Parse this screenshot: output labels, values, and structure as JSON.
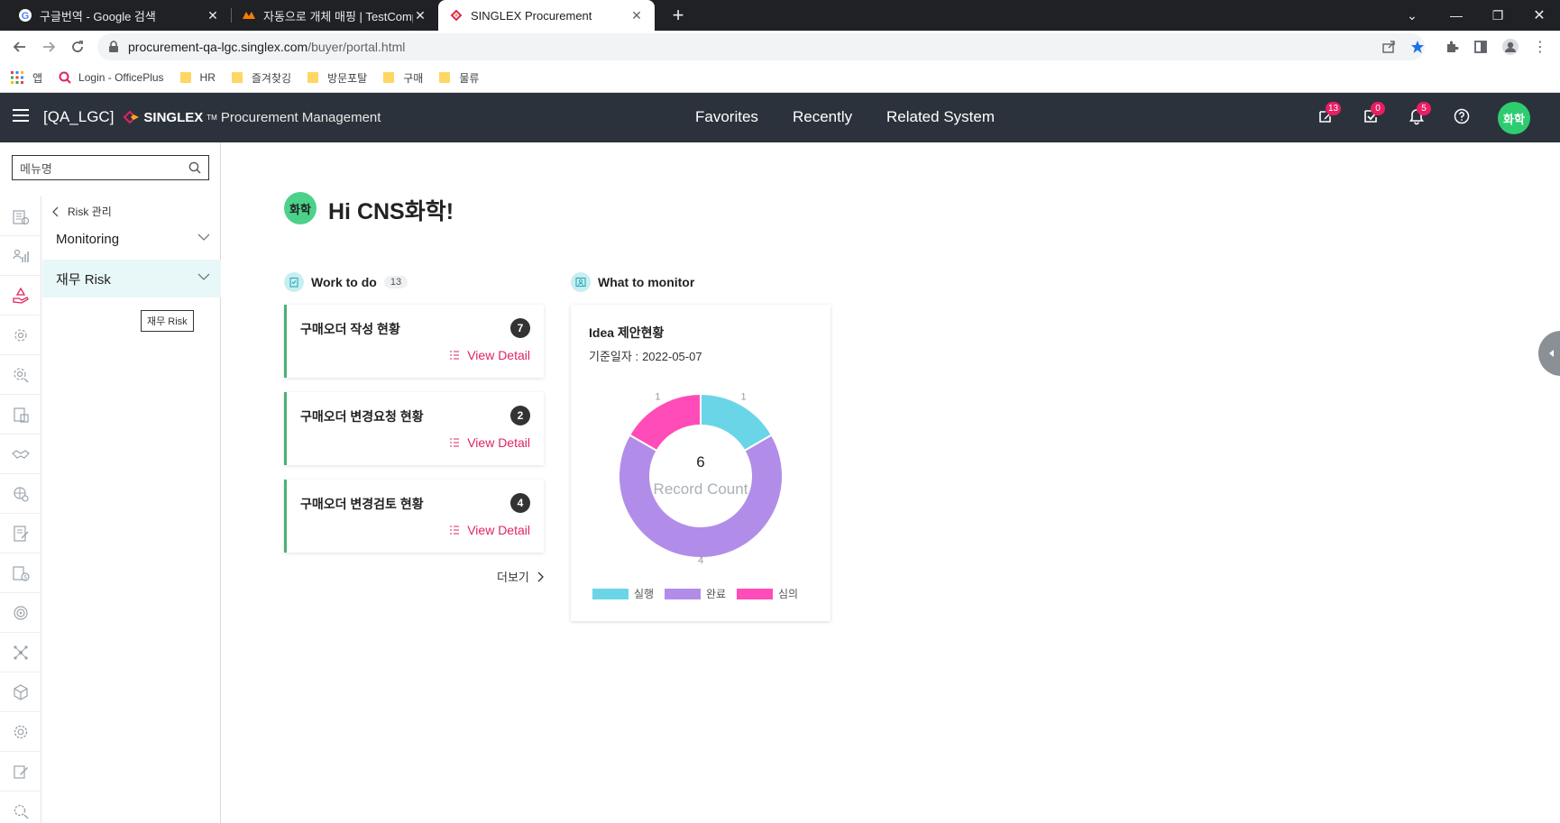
{
  "browser": {
    "tabs": [
      {
        "title": "구글번역 - Google 검색",
        "icon": "google-icon"
      },
      {
        "title": "자동으로 개체 매핑 | TestComplete",
        "icon": "testcomplete-icon"
      },
      {
        "title": "SINGLEX Procurement",
        "icon": "singlex-icon"
      }
    ],
    "new_tab": "+",
    "url_host": "procurement-qa-lgc.singlex.com",
    "url_path": "/buyer/portal.html",
    "bookmarks": [
      {
        "label": "앱",
        "icon": "apps-icon"
      },
      {
        "label": "Login - OfficePlus",
        "icon": "officeplus-icon"
      },
      {
        "label": "HR",
        "icon": "folder-icon"
      },
      {
        "label": "즐겨찾깅",
        "icon": "folder-icon"
      },
      {
        "label": "방문포탈",
        "icon": "folder-icon"
      },
      {
        "label": "구매",
        "icon": "folder-icon"
      },
      {
        "label": "물류",
        "icon": "folder-icon"
      }
    ]
  },
  "header": {
    "company_code": "[QA_LGC]",
    "logo": "SINGLEX",
    "tm": "TM",
    "product": "Procurement Management",
    "nav": [
      "Favorites",
      "Recently",
      "Related System"
    ],
    "badges": {
      "edit": "13",
      "approval": "0",
      "notification": "5"
    },
    "avatar": "화학"
  },
  "sidebar": {
    "search_placeholder": "메뉴명",
    "back_label": "Risk 관리",
    "items": [
      {
        "label": "Monitoring"
      },
      {
        "label": "재무 Risk"
      }
    ],
    "tooltip": "재무 Risk"
  },
  "main": {
    "avatar": "화학",
    "greeting": "Hi CNS화학!",
    "work": {
      "title": "Work to do",
      "count": "13",
      "cards": [
        {
          "title": "구매오더 작성 현황",
          "count": "7",
          "detail": "View Detail"
        },
        {
          "title": "구매오더 변경요청 현황",
          "count": "2",
          "detail": "View Detail"
        },
        {
          "title": "구매오더 변경검토 현황",
          "count": "4",
          "detail": "View Detail"
        }
      ],
      "more": "더보기"
    },
    "monitor": {
      "title": "What to monitor",
      "card_title": "Idea 제안현황",
      "date_label": "기준일자 :",
      "date": "2022-05-07"
    }
  },
  "chart_data": {
    "type": "pie",
    "title": "Idea 제안현황",
    "center_value": "6",
    "center_label": "Record Count",
    "legend_position": "bottom",
    "categories": [
      "실행",
      "완료",
      "심의"
    ],
    "values": [
      1,
      4,
      1
    ],
    "colors": [
      "#6bd5e8",
      "#b18de9",
      "#ff4cb8"
    ]
  }
}
